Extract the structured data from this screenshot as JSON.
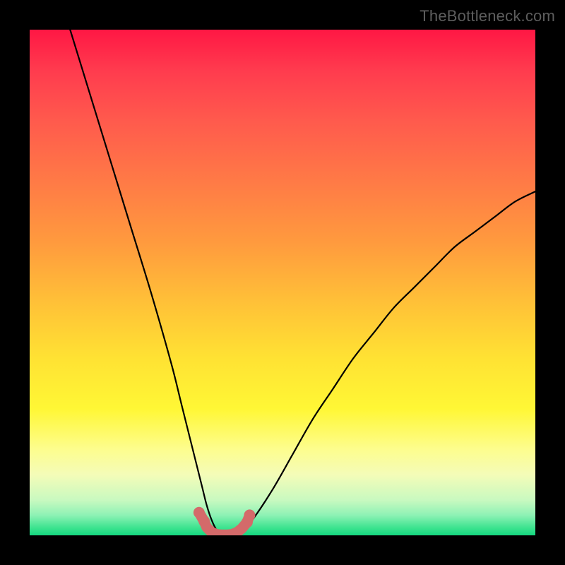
{
  "watermark": {
    "text": "TheBottleneck.com"
  },
  "colors": {
    "background": "#000000",
    "curve_stroke": "#000000",
    "marker_stroke": "#d46a6a",
    "marker_fill": "#d46a6a",
    "watermark_text": "#5d5d5d"
  },
  "chart_data": {
    "type": "line",
    "title": "",
    "xlabel": "",
    "ylabel": "",
    "xlim": [
      0,
      100
    ],
    "ylim": [
      0,
      100
    ],
    "grid": false,
    "legend": false,
    "series": [
      {
        "name": "bottleneck-curve",
        "x": [
          8,
          12,
          16,
          20,
          24,
          28,
          30,
          32,
          34,
          35,
          36,
          37,
          38,
          39,
          40,
          42,
          44,
          48,
          52,
          56,
          60,
          64,
          68,
          72,
          76,
          80,
          84,
          88,
          92,
          96,
          100
        ],
        "y": [
          100,
          87,
          74,
          61,
          48,
          34,
          26,
          18,
          10,
          6,
          3,
          1,
          0,
          0,
          0,
          1,
          3,
          9,
          16,
          23,
          29,
          35,
          40,
          45,
          49,
          53,
          57,
          60,
          63,
          66,
          68
        ]
      }
    ],
    "highlighted_points": {
      "name": "near-zero-markers",
      "x": [
        33.5,
        34.5,
        35,
        36,
        37,
        38,
        39,
        40,
        41,
        42,
        43,
        43.5
      ],
      "y": [
        4.5,
        2.8,
        1.6,
        0.6,
        0.2,
        0.1,
        0.1,
        0.2,
        0.6,
        1.4,
        2.6,
        4.0
      ]
    }
  }
}
